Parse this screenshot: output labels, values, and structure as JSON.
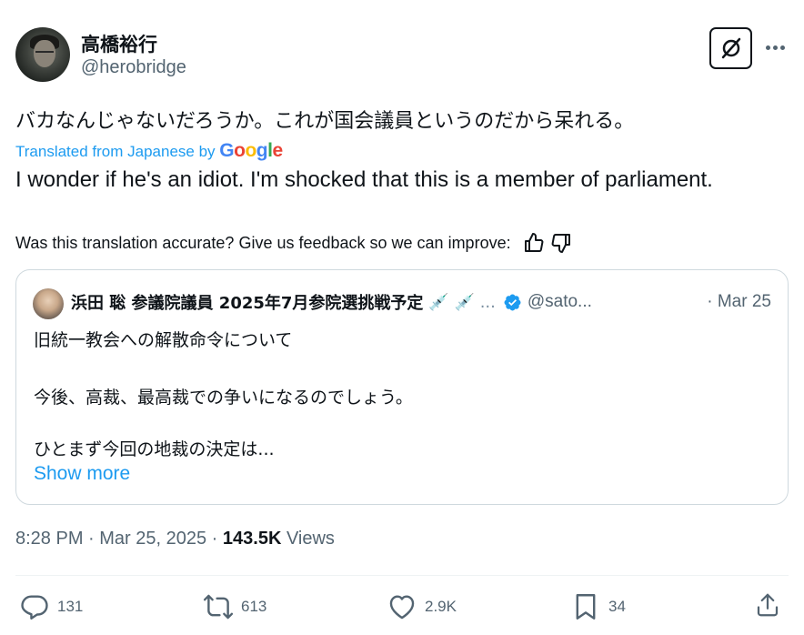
{
  "author": {
    "display_name": "高橋裕行",
    "handle": "@herobridge"
  },
  "tweet": {
    "text": "バカなんじゃないだろうか。これが国会議員というのだから呆れる。",
    "translated_from": "Translated from Japanese by ",
    "google_logo": [
      "G",
      "o",
      "o",
      "g",
      "l",
      "e"
    ],
    "translation": "I wonder if he's an idiot. I'm shocked that this is a member of parliament.",
    "feedback_prompt": "Was this translation accurate? Give us feedback so we can improve:"
  },
  "quote": {
    "name": "浜田 聡 参議院議員 2025年7月参院選挑戦予定",
    "emoji": "💉 💉 ...",
    "handle": "@sato...",
    "date": "· Mar 25",
    "lines": [
      "旧統一教会への解散命令について",
      "今後、高裁、最高裁での争いになるのでしょう。",
      "ひとまず今回の地裁の決定は..."
    ],
    "show_more": "Show more"
  },
  "meta": {
    "time_date": "8:28 PM · Mar 25, 2025 · ",
    "views_count": "143.5K",
    "views_label": " Views"
  },
  "actions": {
    "replies": "131",
    "reposts": "613",
    "likes": "2.9K",
    "bookmarks": "34"
  },
  "colors": {
    "accent": "#1d9bf0",
    "secondary_text": "#536471",
    "border": "#cfd9de",
    "google_blue": "#4285F4",
    "google_red": "#EA4335",
    "google_yellow": "#FBBC05",
    "google_green": "#34A853"
  },
  "icons": [
    "grok-icon",
    "more-icon",
    "thumbs-up-icon",
    "thumbs-down-icon",
    "verified-badge-icon",
    "reply-icon",
    "repost-icon",
    "like-icon",
    "bookmark-icon",
    "share-icon"
  ]
}
